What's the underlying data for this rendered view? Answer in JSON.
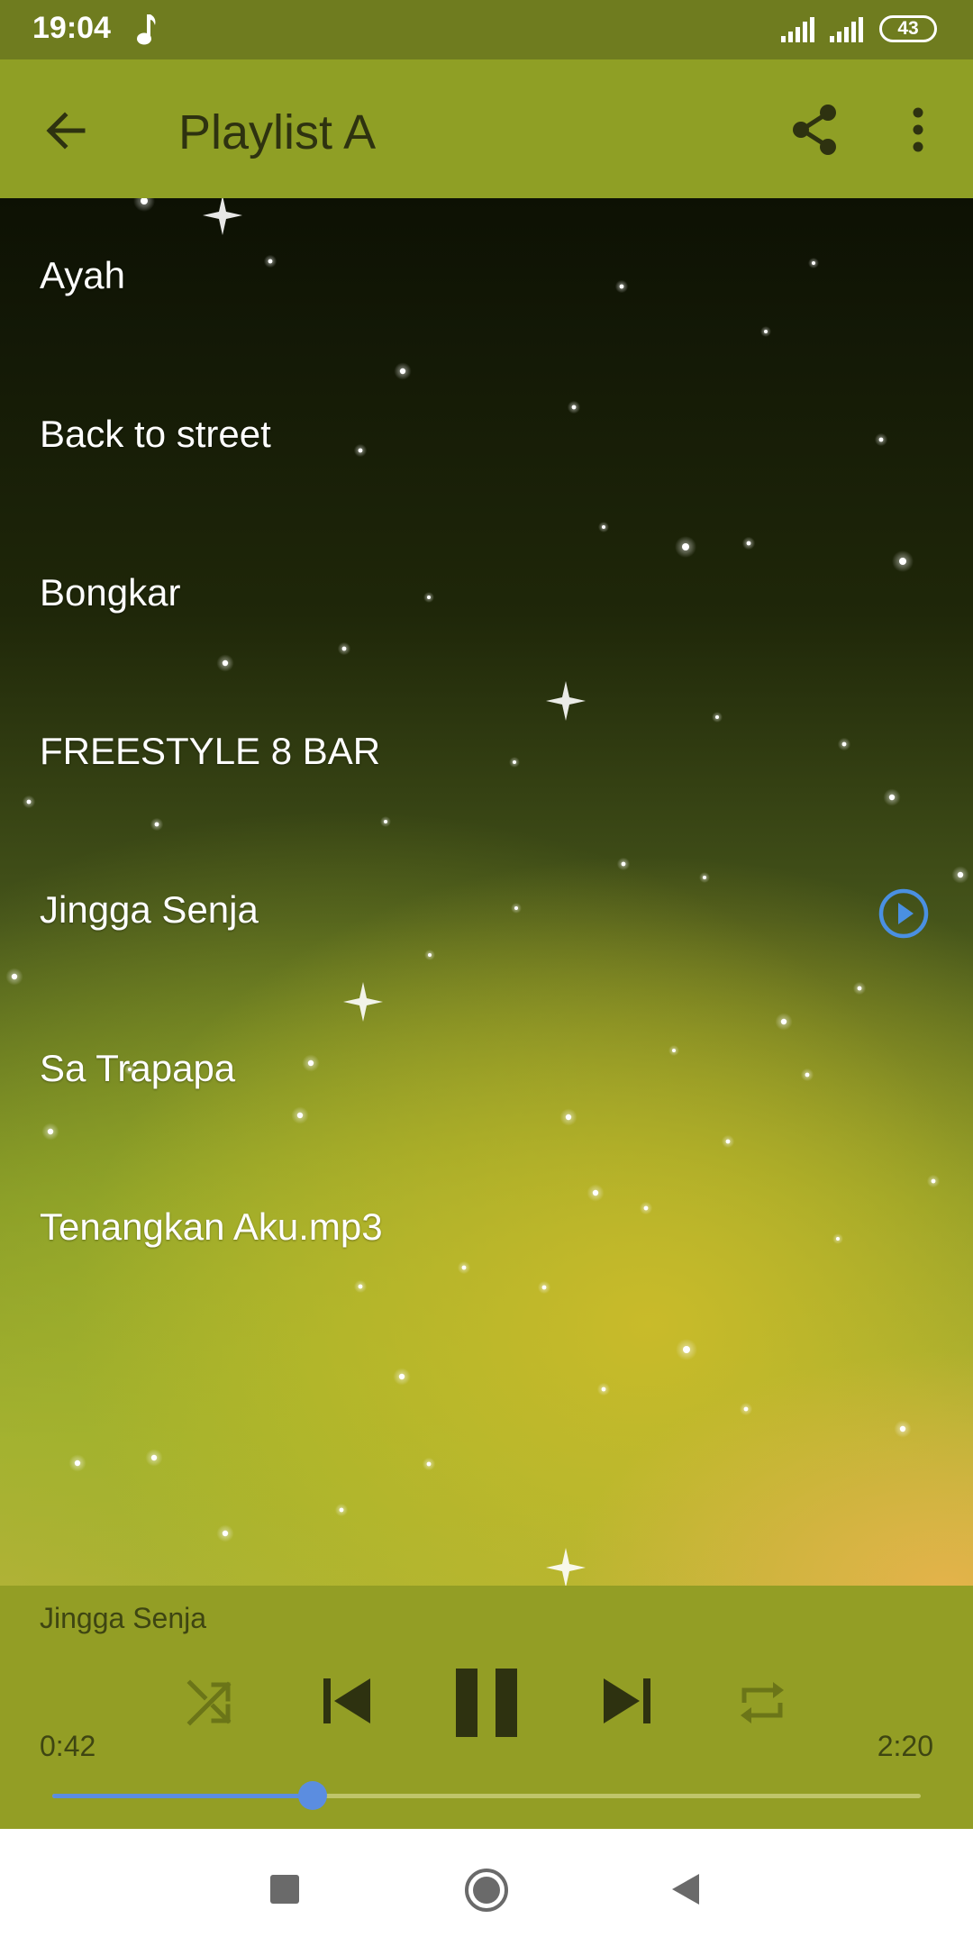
{
  "status_bar": {
    "time": "19:04",
    "battery": "43",
    "icons": [
      "music-note-icon",
      "signal-icon",
      "signal-icon",
      "battery-icon"
    ]
  },
  "app_bar": {
    "title": "Playlist A",
    "icons": [
      "back-arrow-icon",
      "share-icon",
      "more-vert-icon"
    ]
  },
  "songs": [
    {
      "label": "Ayah",
      "playing": false
    },
    {
      "label": "Back to street",
      "playing": false
    },
    {
      "label": "Bongkar",
      "playing": false
    },
    {
      "label": "FREESTYLE 8 BAR",
      "playing": false
    },
    {
      "label": "Jingga Senja",
      "playing": true
    },
    {
      "label": "Sa Trapapa",
      "playing": false
    },
    {
      "label": "Tenangkan Aku.mp3",
      "playing": false
    }
  ],
  "player": {
    "current_title": "Jingga Senja",
    "elapsed": "0:42",
    "duration": "2:20",
    "progress_fraction": 0.3,
    "state": "playing",
    "controls": [
      "shuffle-icon",
      "skip-previous-icon",
      "pause-icon",
      "skip-next-icon",
      "repeat-icon"
    ]
  },
  "colors": {
    "status_bar": "#6f7c1f",
    "app_bar": "#8f9f25",
    "player_bar": "#939e25",
    "accent": "#5b8de0",
    "playing_indicator": "#4a90e2"
  },
  "nav_bar": {
    "icons": [
      "recents-square-icon",
      "home-circle-icon",
      "back-triangle-icon"
    ]
  }
}
